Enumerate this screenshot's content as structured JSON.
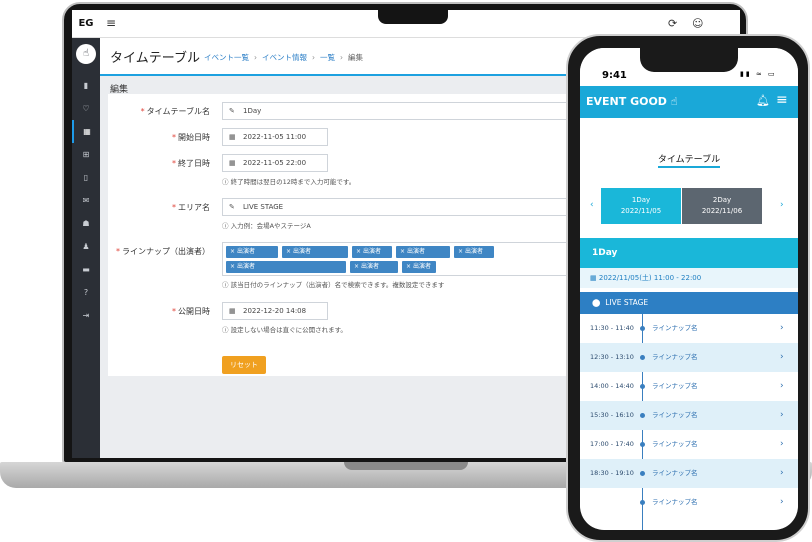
{
  "laptop": {
    "brand": "EG",
    "topbar": {
      "menu_icon": "≡",
      "refresh_icon": "⟳",
      "user_icon": "☺"
    },
    "sidebar_icons": [
      "▮",
      "♡",
      "▦",
      "⊞",
      "▯",
      "✉",
      "☗",
      "♟",
      "▬",
      "?",
      "⇥"
    ],
    "page_title": "タイムテーブル",
    "breadcrumb": [
      "イベント一覧",
      "イベント情報",
      "一覧",
      "編集"
    ],
    "section_label": "編集",
    "form": {
      "timetable_name": {
        "label": "タイムテーブル名",
        "value": "1Day"
      },
      "start": {
        "label": "開始日時",
        "value": "2022-11-05 11:00"
      },
      "end": {
        "label": "終了日時",
        "value": "2022-11-05 22:00",
        "hint": "終了時間は翌日の12時まで入力可能です。"
      },
      "area": {
        "label": "エリア名",
        "value": "LIVE STAGE",
        "hint": "入力例：会場AやステージA"
      },
      "lineup": {
        "label": "ラインナップ（出演者）",
        "tags": [
          "出演者",
          "出演者",
          "出演者",
          "出演者",
          "出演者",
          "出演者",
          "出演者",
          "出演者"
        ],
        "hint": "該当日付のラインナップ（出演者）名で検索できます。複数設定できます"
      },
      "publish": {
        "label": "公開日時",
        "value": "2022-12-20 14:08",
        "hint": "設定しない場合は直ぐに公開されます。"
      },
      "required_mark": "*",
      "reset_label": "リセット"
    }
  },
  "phone": {
    "time": "9:41",
    "status_icons": "▮▮ ≈ ▭",
    "logo": "EVENT GOOD",
    "section_title": "タイムテーブル",
    "days": [
      {
        "label": "1Day",
        "date": "2022/11/05",
        "active": true
      },
      {
        "label": "2Day",
        "date": "2022/11/06",
        "active": false
      }
    ],
    "arrow_left": "‹",
    "arrow_right": "›",
    "day_heading": "1Day",
    "day_time": "2022/11/05(土) 11:00 - 22:00",
    "stage": "LIVE STAGE",
    "schedule": [
      {
        "time": "11:30 - 11:40",
        "name": "ラインナップ名"
      },
      {
        "time": "12:30 - 13:10",
        "name": "ラインナップ名"
      },
      {
        "time": "14:00 - 14:40",
        "name": "ラインナップ名"
      },
      {
        "time": "15:30 - 16:10",
        "name": "ラインナップ名"
      },
      {
        "time": "17:00 - 17:40",
        "name": "ラインナップ名"
      },
      {
        "time": "18:30 - 19:10",
        "name": "ラインナップ名"
      },
      {
        "time": "",
        "name": "ラインナップ名"
      }
    ]
  }
}
